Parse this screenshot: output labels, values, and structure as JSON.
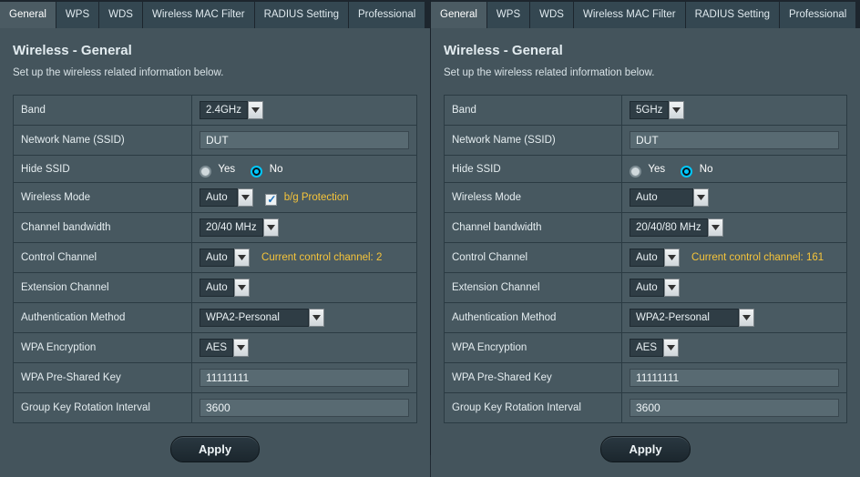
{
  "tabs": [
    "General",
    "WPS",
    "WDS",
    "Wireless MAC Filter",
    "RADIUS Setting",
    "Professional"
  ],
  "active_tab": "General",
  "page_title": "Wireless - General",
  "page_sub": "Set up the wireless related information below.",
  "labels": {
    "band": "Band",
    "ssid": "Network Name (SSID)",
    "hide": "Hide SSID",
    "mode": "Wireless Mode",
    "bw": "Channel bandwidth",
    "ctrl": "Control Channel",
    "ext": "Extension Channel",
    "auth": "Authentication Method",
    "enc": "WPA Encryption",
    "psk": "WPA Pre-Shared Key",
    "gkri": "Group Key Rotation Interval"
  },
  "common": {
    "yes": "Yes",
    "no": "No",
    "apply": "Apply",
    "bg_protect": "b/g Protection",
    "ctrl_prefix": "Current control channel: "
  },
  "left": {
    "band": "2.4GHz",
    "ssid": "DUT",
    "hide": "No",
    "mode": "Auto",
    "bg_protect_checked": true,
    "bw": "20/40 MHz",
    "ctrl": "Auto",
    "ctrl_current": "2",
    "ext": "Auto",
    "auth": "WPA2-Personal",
    "enc": "AES",
    "psk": "11111111",
    "gkri": "3600"
  },
  "right": {
    "band": "5GHz",
    "ssid": "DUT",
    "hide": "No",
    "mode": "Auto",
    "bw": "20/40/80 MHz",
    "ctrl": "Auto",
    "ctrl_current": "161",
    "ext": "Auto",
    "auth": "WPA2-Personal",
    "enc": "AES",
    "psk": "11111111",
    "gkri": "3600"
  }
}
